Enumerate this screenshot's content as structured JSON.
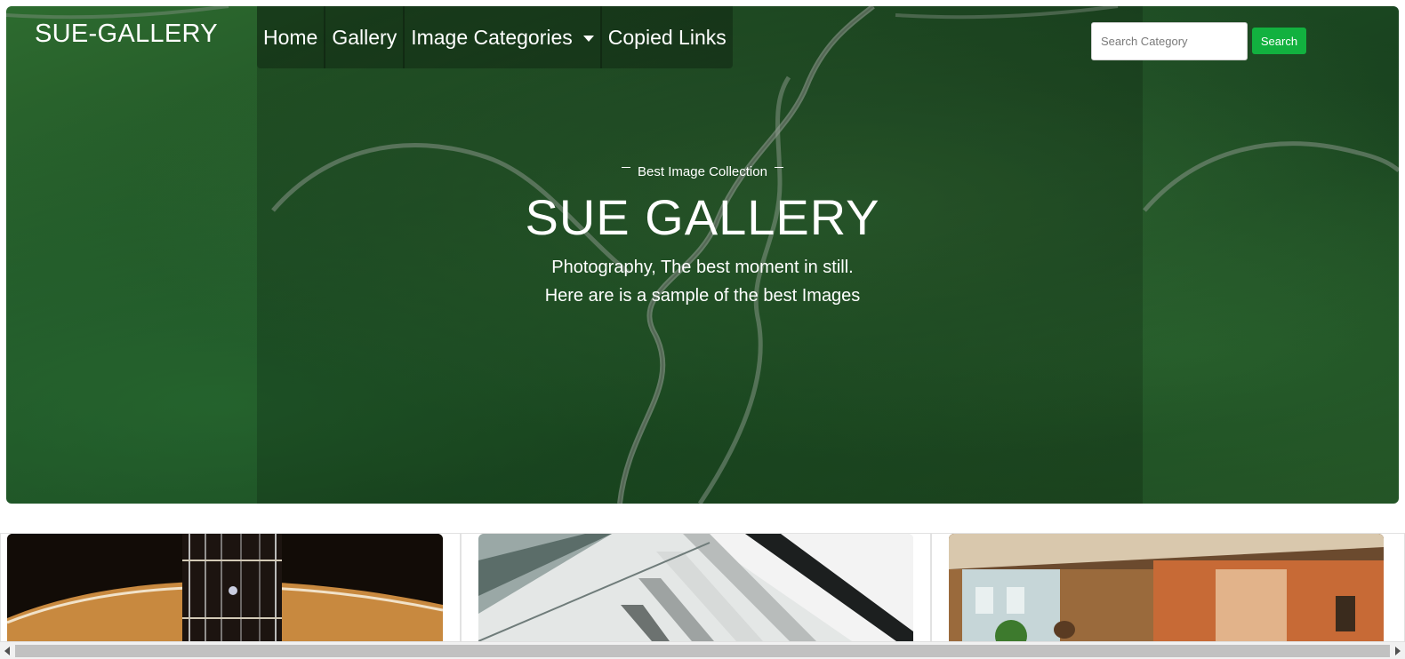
{
  "brand": "SUE-GALLERY",
  "nav": [
    {
      "label": "Home"
    },
    {
      "label": "Gallery"
    },
    {
      "label": "Image Categories",
      "dropdown": true
    },
    {
      "label": "Copied Links"
    }
  ],
  "search": {
    "placeholder": "Search Category",
    "value": "",
    "button_label": "Search",
    "button_color": "#12b13f"
  },
  "hero": {
    "tagline": "Best Image Collection",
    "title": "SUE GALLERY",
    "subtitle_line1": "Photography, The best moment in still.",
    "subtitle_line2": "Here are is a sample of the best Images",
    "background_color": "#1f4f25"
  },
  "gallery": {
    "images": [
      {
        "subject": "guitar-image"
      },
      {
        "subject": "architecture-image"
      },
      {
        "subject": "building-market-image"
      }
    ]
  }
}
